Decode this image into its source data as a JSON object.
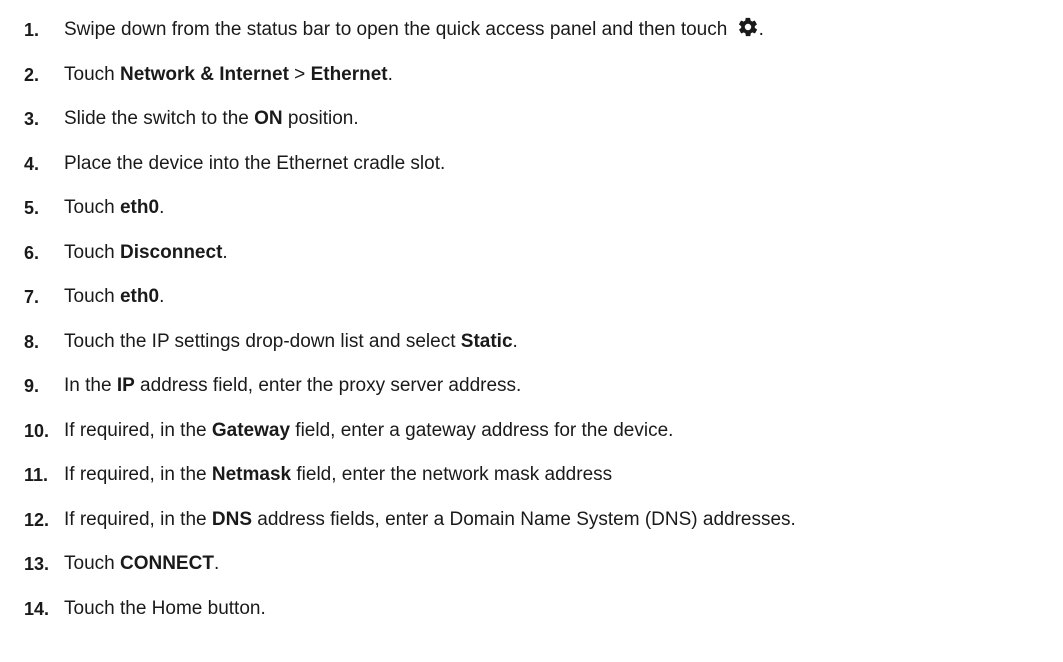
{
  "steps": [
    {
      "num": "1.",
      "parts": [
        "Swipe down from the status bar to open the quick access panel and then touch ",
        "",
        "."
      ]
    },
    {
      "num": "2.",
      "parts": [
        "Touch ",
        "Network & Internet",
        " > ",
        "Ethernet",
        "."
      ]
    },
    {
      "num": "3.",
      "parts": [
        "Slide the switch to the ",
        "ON",
        " position."
      ]
    },
    {
      "num": "4.",
      "parts": [
        "Place the device into the Ethernet cradle slot."
      ]
    },
    {
      "num": "5.",
      "parts": [
        "Touch ",
        "eth0",
        "."
      ]
    },
    {
      "num": "6.",
      "parts": [
        "Touch ",
        "Disconnect",
        "."
      ]
    },
    {
      "num": "7.",
      "parts": [
        "Touch ",
        "eth0",
        "."
      ]
    },
    {
      "num": "8.",
      "parts": [
        "Touch the IP settings drop-down list and select ",
        "Static",
        "."
      ]
    },
    {
      "num": "9.",
      "parts": [
        "In the ",
        "IP",
        " address field, enter the proxy server address."
      ]
    },
    {
      "num": "10.",
      "parts": [
        "If required, in the ",
        "Gateway",
        " field, enter a gateway address for the device."
      ]
    },
    {
      "num": "11.",
      "parts": [
        "If required, in the ",
        "Netmask",
        " field, enter the network mask address"
      ]
    },
    {
      "num": "12.",
      "parts": [
        "If required, in the ",
        "DNS",
        " address fields, enter a Domain Name System (DNS) addresses."
      ]
    },
    {
      "num": "13.",
      "parts": [
        "Touch ",
        "CONNECT",
        "."
      ]
    },
    {
      "num": "14.",
      "parts": [
        "Touch the Home button."
      ]
    }
  ],
  "icons": {
    "settings": "gear-icon"
  }
}
